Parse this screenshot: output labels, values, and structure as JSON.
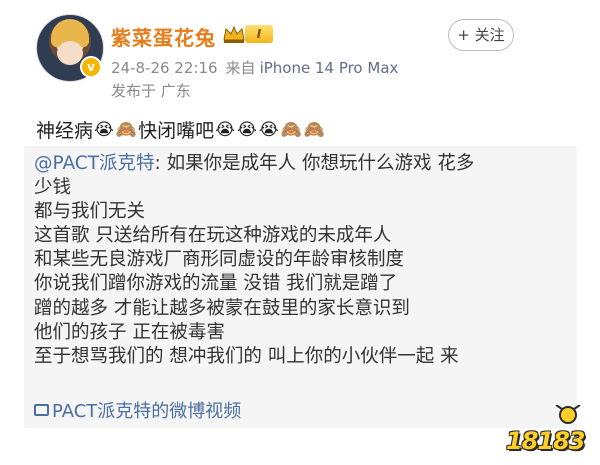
{
  "user": {
    "name": "紫菜蛋花兔",
    "level": "I",
    "avatar_icon": "avatar-image",
    "verified_icon": "verified-badge-icon"
  },
  "follow_button": {
    "label": "+ 关注"
  },
  "meta": {
    "timestamp": "24-8-26 22:16",
    "source_prefix": "来自",
    "device": "iPhone 14 Pro Max",
    "location": "发布于 广东"
  },
  "post": {
    "text_part1": "神经病",
    "emoji_cry": "😭",
    "emoji_monkey": "🙈",
    "text_part2": "快闭嘴吧"
  },
  "repost": {
    "mention": "@PACT派克特",
    "line1_rest": ": 如果你是成年人 你想玩什么游戏 花多",
    "lines": [
      "少钱",
      "都与我们无关",
      "这首歌 只送给所有在玩这种游戏的未成年人",
      "和某些无良游戏厂商形同虚设的年龄审核制度",
      "你说我们蹭你游戏的流量 没错 我们就是蹭了",
      "蹭的越多 才能让越多被蒙在鼓里的家长意识到",
      "他们的孩子 正在被毒害",
      "至于想骂我们的 想冲我们的 叫上你的小伙伴一起 来"
    ],
    "video_link": "PACT派克特的微博视频"
  },
  "watermark": {
    "text": "18183"
  },
  "colors": {
    "username": "#e77c1b",
    "link": "#4c6fa3",
    "meta": "#8a8a8a",
    "repost_bg": "#f5f5f5"
  }
}
